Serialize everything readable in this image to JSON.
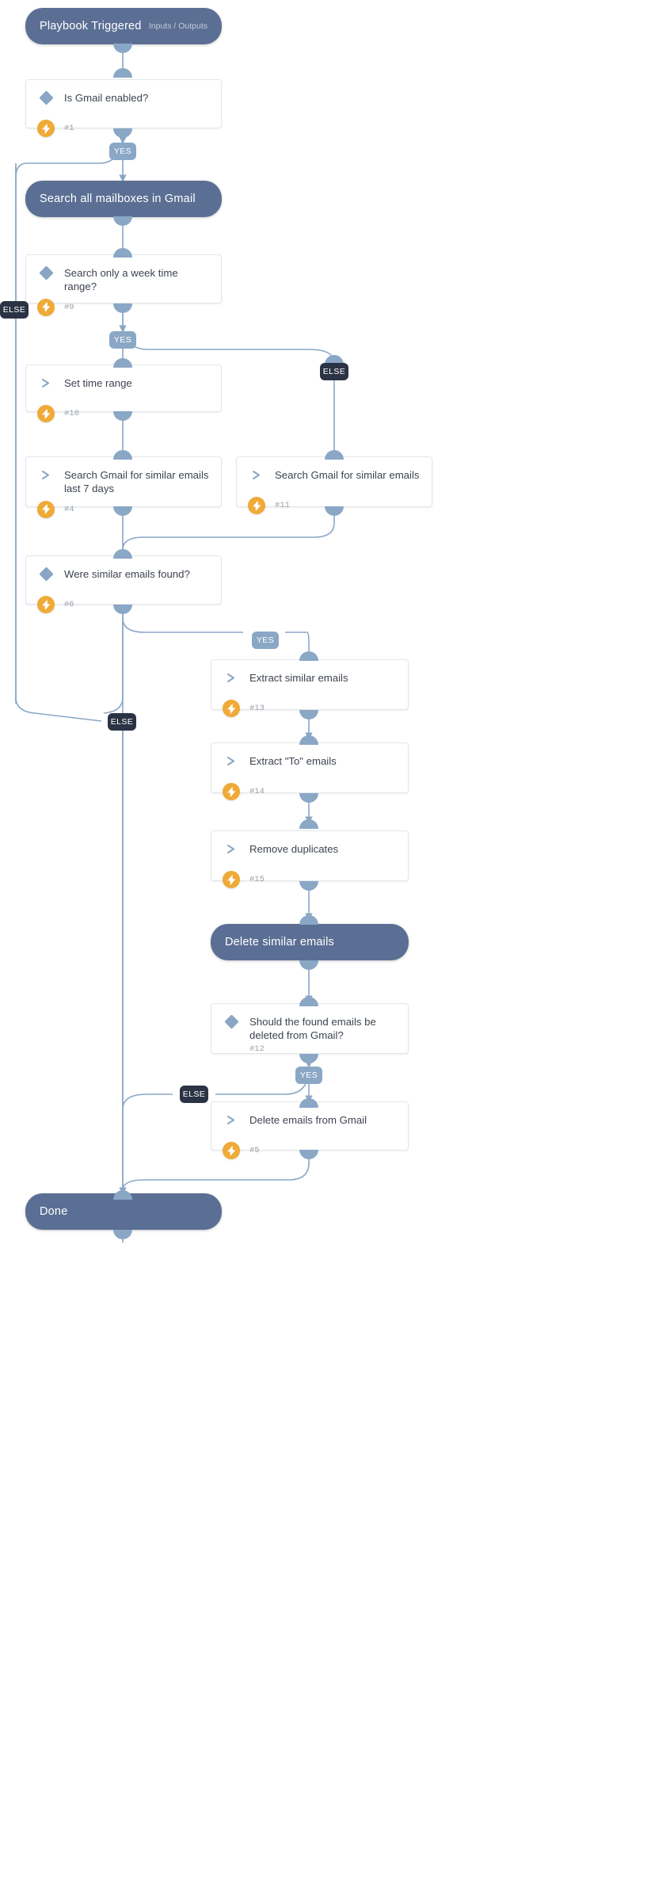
{
  "diagram": {
    "type": "playbook-flowchart",
    "title": "Gmail similar-email search & delete playbook",
    "colors": {
      "pill_bg": "#5b6f94",
      "card_bg": "#ffffff",
      "card_border": "#e3e6ea",
      "connector": "#8ba7c6",
      "badge_yes_bg": "#8ba7c6",
      "badge_else_bg": "#2b3444",
      "bolt_bg": "#efaa37",
      "diamond_icon": "#8aa6c4",
      "text_primary": "#3d4450",
      "ref_text": "#9aa1ab"
    }
  },
  "nodes": {
    "start": {
      "kind": "pill",
      "title": "Playbook Triggered",
      "subtitle": "Inputs / Outputs"
    },
    "is_gmail_enabled": {
      "kind": "decision",
      "label": "Is Gmail enabled?",
      "ref": "#1",
      "icon": "diamond-icon"
    },
    "search_all_mailboxes": {
      "kind": "pill",
      "title": "Search all mailboxes in Gmail",
      "subtitle": ""
    },
    "week_time_range": {
      "kind": "decision",
      "label": "Search only a week time range?",
      "ref": "#9",
      "icon": "diamond-icon"
    },
    "set_time_range": {
      "kind": "action",
      "label": "Set time range",
      "ref": "#10",
      "icon": "chevron-right-icon"
    },
    "search_last_7_days": {
      "kind": "action",
      "label": "Search Gmail for similar emails last 7 days",
      "ref": "#4",
      "icon": "chevron-right-icon"
    },
    "search_similar": {
      "kind": "action",
      "label": "Search Gmail for similar emails",
      "ref": "#11",
      "icon": "chevron-right-icon"
    },
    "were_found": {
      "kind": "decision",
      "label": "Were similar emails found?",
      "ref": "#6",
      "icon": "diamond-icon"
    },
    "extract_similar": {
      "kind": "action",
      "label": "Extract similar emails",
      "ref": "#13",
      "icon": "chevron-right-icon"
    },
    "extract_to": {
      "kind": "action",
      "label": "Extract \"To\" emails",
      "ref": "#14",
      "icon": "chevron-right-icon"
    },
    "remove_duplicates": {
      "kind": "action",
      "label": "Remove duplicates",
      "ref": "#15",
      "icon": "chevron-right-icon"
    },
    "delete_similar": {
      "kind": "pill",
      "title": "Delete similar emails",
      "subtitle": ""
    },
    "should_delete": {
      "kind": "decision",
      "label": "Should the found emails be deleted from Gmail?",
      "ref": "#12",
      "icon": "diamond-icon"
    },
    "delete_from_gmail": {
      "kind": "action",
      "label": "Delete emails from Gmail",
      "ref": "#5",
      "icon": "chevron-right-icon"
    },
    "done": {
      "kind": "pill",
      "title": "Done",
      "subtitle": ""
    }
  },
  "branch_labels": {
    "yes_1": "YES",
    "else_1": "ELSE",
    "yes_2": "YES",
    "else_2": "ELSE",
    "yes_3": "YES",
    "else_3": "ELSE",
    "yes_4": "YES",
    "else_4": "ELSE"
  }
}
